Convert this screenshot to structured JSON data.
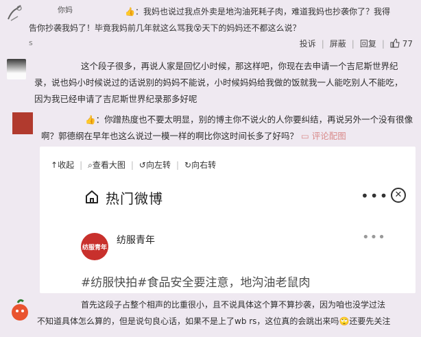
{
  "comment1": {
    "username": "你妈",
    "line1": "：我妈也说过我点外卖是地沟油死耗子肉，难道我妈也抄袭你了？我得",
    "line2": "告你抄袭我妈了！毕竟我妈前几年就这么骂我",
    "line2_tail": "天下的妈妈还不都这么说？",
    "s_char": "s",
    "actions": {
      "report": "投诉",
      "block": "屏蔽",
      "reply": "回复",
      "likes": "77"
    }
  },
  "comment2": {
    "lines": [
      "这个段子很多，再说人家是回忆小时候，那这样吧，你现在去申请一个吉尼斯世界纪",
      "录，说也妈小时候说过的话说别的妈妈不能说，小时候妈妈给我做的饭就我一人能吃别人不能吃，",
      "因为我已经申请了吉尼斯世界纪录那多好呢"
    ]
  },
  "comment3": {
    "line1": "：你蹭热度也不要太明显，别的博主你不说火的人你要纠结，再说另外一个没有很像",
    "line2": "啊？郭德纲在早年也这么说过一模一样的啊比你这时间长多了好吗？",
    "link": "评论配图"
  },
  "viewer": {
    "toolbar": {
      "collapse": "收起",
      "view_large": "查看大图",
      "rotate_left": "向左转",
      "rotate_right": "向右转"
    },
    "title": "热门微博",
    "account_name": "纺服青年",
    "account_logo": "纺服青年",
    "topic": "#纺服快拍#食品安全要注意，地沟油老鼠肉"
  },
  "comment4": {
    "line1": "首先这段子占整个相声的比重很小，且不说具体这个算不算抄袭，因为咱也没学过法",
    "line2": "不知道具体怎么算的，但是说句良心话，如果不是上了wb rs，这位真的会跳出来吗",
    "line2_tail": "还要先关注"
  },
  "colors": {
    "background": "#efe9f1",
    "link": "#d98a8a",
    "logo": "#c8302c"
  }
}
